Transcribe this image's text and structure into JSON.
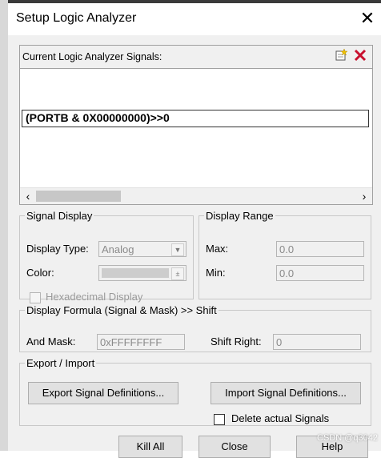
{
  "dialog": {
    "title": "Setup Logic Analyzer",
    "close_glyph": "✕"
  },
  "signals": {
    "header_label": "Current Logic Analyzer Signals:",
    "new_icon": "new-signal-icon",
    "delete_icon": "delete-signal-icon",
    "items": [
      "(PORTB & 0X00000000)>>0"
    ]
  },
  "signal_display": {
    "legend": "Signal Display",
    "type_label": "Display Type:",
    "type_value": "Analog",
    "color_label": "Color:",
    "hex_label": "Hexadecimal Display"
  },
  "display_range": {
    "legend": "Display Range",
    "max_label": "Max:",
    "max_value": "0.0",
    "min_label": "Min:",
    "min_value": "0.0"
  },
  "formula": {
    "legend": "Display Formula (Signal & Mask) >> Shift",
    "mask_label": "And Mask:",
    "mask_value": "0xFFFFFFFF",
    "shift_label": "Shift Right:",
    "shift_value": "0"
  },
  "export_import": {
    "legend": "Export / Import",
    "export_label": "Export Signal Definitions...",
    "import_label": "Import Signal Definitions...",
    "delete_label": "Delete actual Signals"
  },
  "footer": {
    "kill_all": "Kill All",
    "close": "Close",
    "help": "Help"
  },
  "watermark": "CSDN @q3042"
}
